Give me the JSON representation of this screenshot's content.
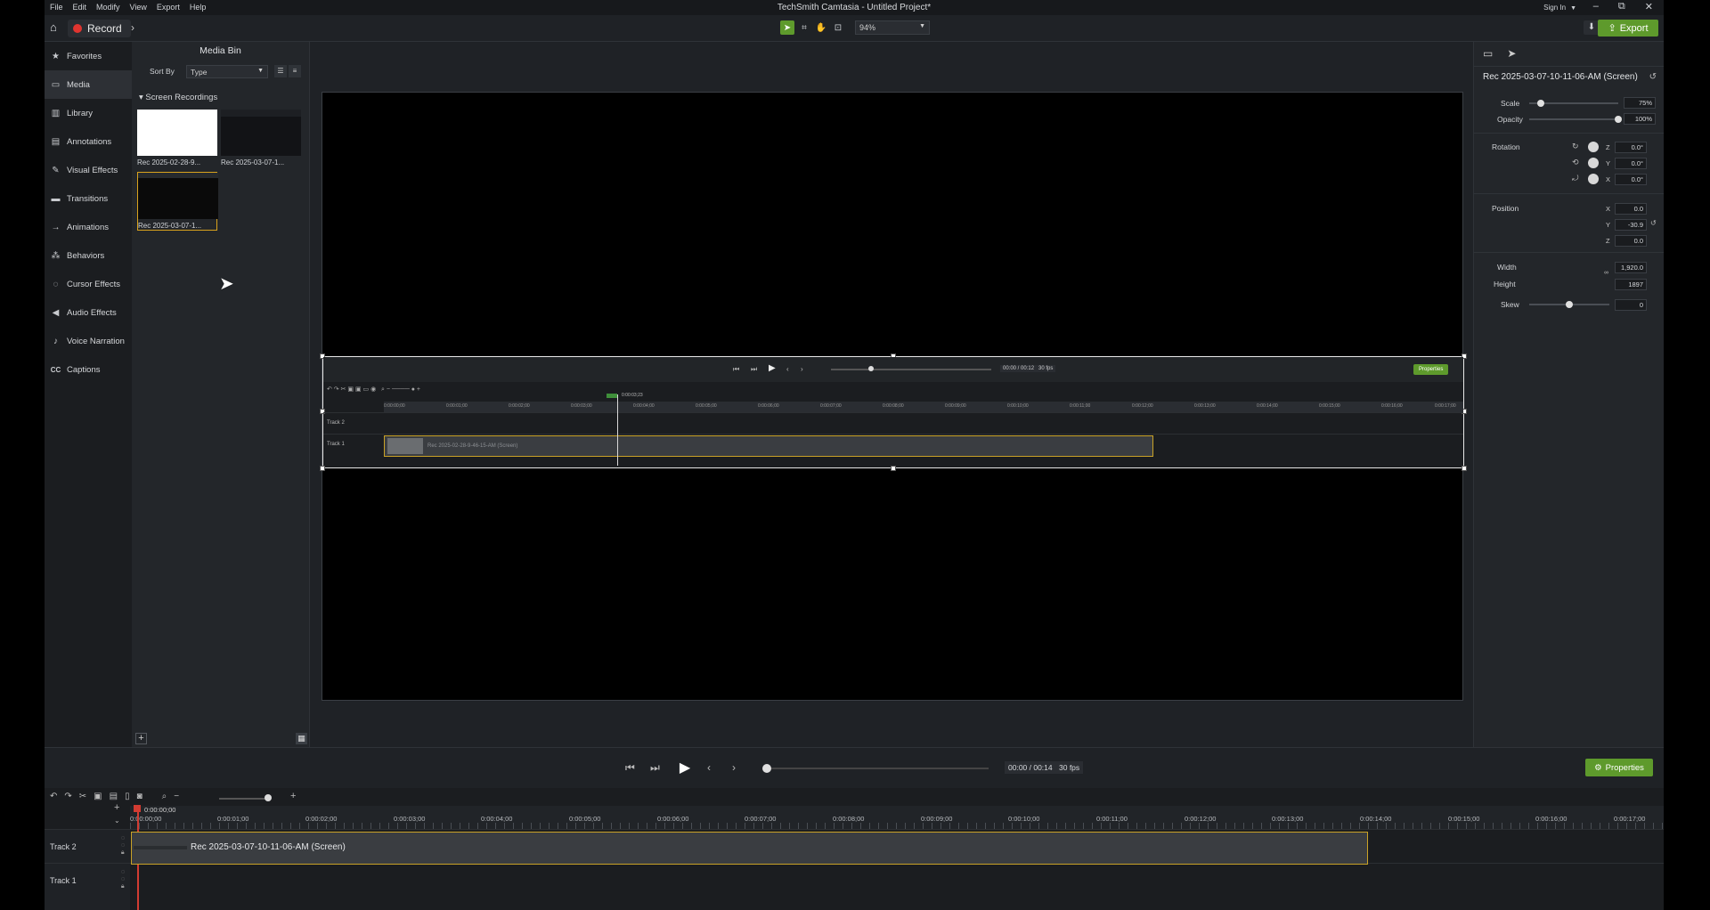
{
  "window": {
    "title": "TechSmith Camtasia - Untitled Project*",
    "menu": [
      "File",
      "Edit",
      "Modify",
      "View",
      "Export",
      "Help"
    ],
    "sign_in": "Sign In",
    "controls": {
      "minimize": "–",
      "restore": "⧉",
      "close": "✕"
    }
  },
  "toolbar": {
    "record_label": "Record",
    "zoom": "94%",
    "export_label": "Export",
    "accent": "#5e9a2c"
  },
  "nav": {
    "items": [
      {
        "label": "Favorites",
        "icon": "star-icon"
      },
      {
        "label": "Media",
        "icon": "media-icon"
      },
      {
        "label": "Library",
        "icon": "library-icon"
      },
      {
        "label": "Annotations",
        "icon": "annotations-icon"
      },
      {
        "label": "Visual Effects",
        "icon": "visual-effects-icon"
      },
      {
        "label": "Transitions",
        "icon": "transitions-icon"
      },
      {
        "label": "Animations",
        "icon": "animations-icon"
      },
      {
        "label": "Behaviors",
        "icon": "behaviors-icon"
      },
      {
        "label": "Cursor Effects",
        "icon": "cursor-effects-icon"
      },
      {
        "label": "Audio Effects",
        "icon": "audio-effects-icon"
      },
      {
        "label": "Voice Narration",
        "icon": "microphone-icon"
      },
      {
        "label": "Captions",
        "icon": "captions-icon"
      }
    ],
    "active": "Media"
  },
  "media_bin": {
    "title": "Media Bin",
    "sort_by_label": "Sort By",
    "sort_value": "Type",
    "section": "Screen Recordings",
    "items": [
      {
        "label": "Rec 2025-02-28-9..."
      },
      {
        "label": "Rec 2025-03-07-1..."
      },
      {
        "label": "Rec 2025-03-07-1..."
      }
    ]
  },
  "nested_preview": {
    "time": "00:00 / 00:12",
    "fps": "30 fps",
    "properties_label": "Properties",
    "playhead_time": "0:00:03;23",
    "ticks": [
      "0:00:00;00",
      "0:00:01;00",
      "0:00:02;00",
      "0:00:03;00",
      "0:00:04;00",
      "0:00:05;00",
      "0:00:06;00",
      "0:00:07;00",
      "0:00:08;00",
      "0:00:09;00",
      "0:00:10;00",
      "0:00:11;00",
      "0:00:12;00",
      "0:00:13;00",
      "0:00:14;00",
      "0:00:15;00",
      "0:00:16;00",
      "0:00:17;00"
    ],
    "track2": "Track 2",
    "track1": "Track 1",
    "clip_label": "Rec 2025-02-28-9-46-15-AM (Screen)"
  },
  "properties": {
    "title": "Rec 2025-03-07-10-11-06-AM (Screen)",
    "scale_label": "Scale",
    "scale": "75%",
    "opacity_label": "Opacity",
    "opacity": "100%",
    "rotation_label": "Rotation",
    "rot_z": "0.0°",
    "rot_y": "0.0°",
    "rot_x": "0.0°",
    "position_label": "Position",
    "pos_x": "0.0",
    "pos_y": "-30.9",
    "pos_z": "0.0",
    "width_label": "Width",
    "width": "1,920.0",
    "height_label": "Height",
    "height": "1897",
    "skew_label": "Skew",
    "skew": "0",
    "axis": {
      "z": "Z",
      "y": "Y",
      "x": "X"
    }
  },
  "playback": {
    "time": "00:00 / 00:14",
    "fps": "30 fps",
    "properties_label": "Properties"
  },
  "timeline": {
    "playhead_time": "0:00:00;00",
    "ticks": [
      "0:00:00;00",
      "0:00:01;00",
      "0:00:02;00",
      "0:00:03;00",
      "0:00:04;00",
      "0:00:05;00",
      "0:00:06;00",
      "0:00:07;00",
      "0:00:08;00",
      "0:00:09;00",
      "0:00:10;00",
      "0:00:11;00",
      "0:00:12;00",
      "0:00:13;00",
      "0:00:14;00",
      "0:00:15;00",
      "0:00:16;00",
      "0:00:17;00"
    ],
    "tracks": [
      "Track 2",
      "Track 1"
    ],
    "clip_label": "Rec 2025-03-07-10-11-06-AM (Screen)"
  }
}
